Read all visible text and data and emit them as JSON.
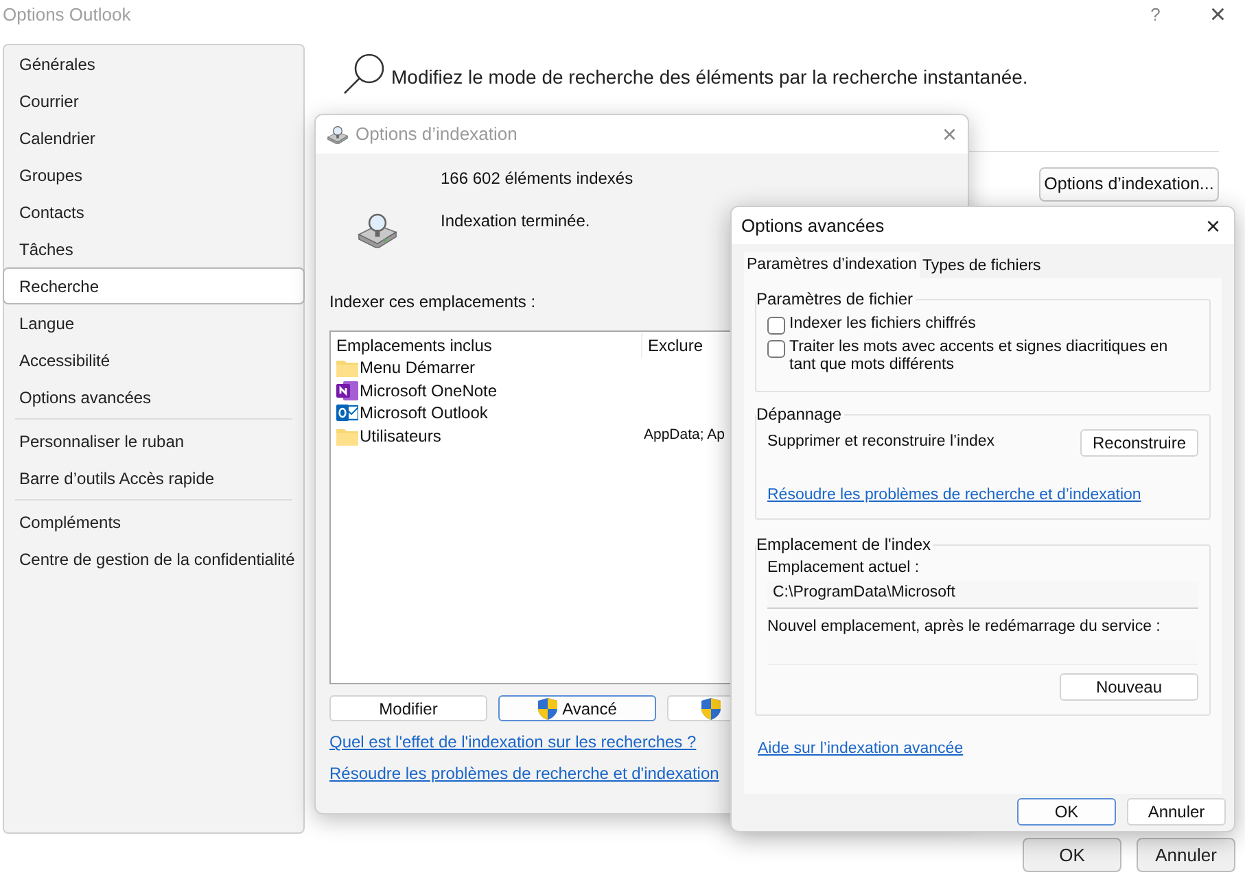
{
  "window": {
    "title": "Options Outlook",
    "help": "?",
    "close": "×"
  },
  "sidebar": {
    "groups": [
      [
        {
          "label": "Générales",
          "selected": false
        },
        {
          "label": "Courrier",
          "selected": false
        },
        {
          "label": "Calendrier",
          "selected": false
        },
        {
          "label": "Groupes",
          "selected": false
        },
        {
          "label": "Contacts",
          "selected": false
        },
        {
          "label": "Tâches",
          "selected": false
        },
        {
          "label": "Recherche",
          "selected": true
        },
        {
          "label": "Langue",
          "selected": false
        },
        {
          "label": "Accessibilité",
          "selected": false
        },
        {
          "label": "Options avancées",
          "selected": false
        }
      ],
      [
        {
          "label": "Personnaliser le ruban",
          "selected": false
        },
        {
          "label": "Barre d’outils Accès rapide",
          "selected": false
        }
      ],
      [
        {
          "label": "Compléments",
          "selected": false
        },
        {
          "label": "Centre de gestion de la confidentialité",
          "selected": false
        }
      ]
    ]
  },
  "search_section": {
    "text": "Modifiez le mode de recherche des éléments par la recherche instantanée.",
    "button": "Options d’indexation..."
  },
  "footer_buttons": [
    {
      "label": "OK"
    },
    {
      "label": "Annuler"
    }
  ],
  "indexing_dialog": {
    "title": "Options d’indexation",
    "close": "×",
    "count": "166 602 éléments indexés",
    "status": "Indexation terminée.",
    "list_label": "Indexer ces emplacements :",
    "columns": [
      "Emplacements inclus",
      "Exclure"
    ],
    "rows": [
      {
        "name": "Menu Démarrer",
        "kind": "folder"
      },
      {
        "name": "Microsoft OneNote",
        "kind": "onenote"
      },
      {
        "name": "Microsoft Outlook",
        "kind": "outlook"
      },
      {
        "name": "Utilisateurs",
        "kind": "folder",
        "exclude": "AppData; Ap"
      }
    ],
    "buttons": [
      {
        "label": "Modifier",
        "kind": "plain",
        "focused": false
      },
      {
        "label": "Avancé",
        "kind": "shield",
        "focused": true
      },
      {
        "kind": "shield",
        "focused": false
      }
    ],
    "links": [
      "Quel est l'effet de l'indexation sur les recherches ?",
      "Résoudre les problèmes de recherche et d'indexation"
    ]
  },
  "advanced_dialog": {
    "title": "Options avancées",
    "close": "×",
    "tabs": [
      {
        "label": "Paramètres d’indexation",
        "selected": true
      },
      {
        "label": "Types de fichiers",
        "selected": false
      }
    ],
    "file_settings": {
      "title": "Paramètres de fichier",
      "options": [
        {
          "label": "Indexer les fichiers chiffrés",
          "checked": false
        },
        {
          "label": "Traiter les mots avec accents et signes diacritiques en tant que mots différents",
          "checked": false
        }
      ]
    },
    "troubleshooting": {
      "title": "Dépannage",
      "text": "Supprimer et reconstruire l’index",
      "button": "Reconstruire",
      "link": "Résoudre les problèmes de recherche et d’indexation"
    },
    "index_location": {
      "title": "Emplacement de l'index",
      "current_label": "Emplacement actuel :",
      "current_value": "C:\\ProgramData\\Microsoft",
      "new_label": "Nouvel emplacement, après le redémarrage du service :",
      "button": "Nouveau"
    },
    "help_link": "Aide sur l’indexation avancée",
    "buttons": [
      {
        "label": "OK",
        "focused": true
      },
      {
        "label": "Annuler",
        "focused": false
      }
    ]
  }
}
